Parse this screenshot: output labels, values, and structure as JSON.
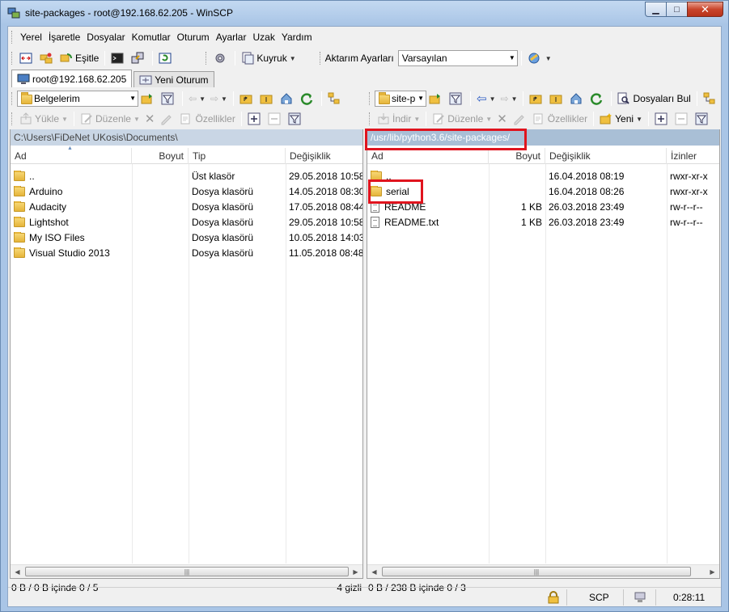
{
  "window": {
    "title": "site-packages - root@192.168.62.205 - WinSCP",
    "controls": {
      "minimize": "▁",
      "maximize": "□",
      "close": "✕"
    }
  },
  "menu": [
    "Yerel",
    "İşaretle",
    "Dosyalar",
    "Komutlar",
    "Oturum",
    "Ayarlar",
    "Uzak",
    "Yardım"
  ],
  "main_toolbar": {
    "sync_label": "Eşitle",
    "queue_label": "Kuyruk",
    "transfer_settings_label": "Aktarım Ayarları",
    "transfer_preset": "Varsayılan"
  },
  "tabs": [
    {
      "label": "root@192.168.62.205",
      "active": true
    },
    {
      "label": "Yeni Oturum",
      "active": false
    }
  ],
  "left": {
    "location": "Belgelerim",
    "actions": {
      "upload": "Yükle",
      "edit": "Düzenle",
      "properties": "Özellikler"
    },
    "path": "C:\\Users\\FiDeNet UKosis\\Documents\\",
    "columns": {
      "name": "Ad",
      "size": "Boyut",
      "type": "Tip",
      "modified": "Değişiklik"
    },
    "rows": [
      {
        "name": "..",
        "size": "",
        "type": "Üst klasör",
        "modified": "29.05.2018  10:58",
        "icon": "parent-folder"
      },
      {
        "name": "Arduino",
        "size": "",
        "type": "Dosya klasörü",
        "modified": "14.05.2018  08:30",
        "icon": "folder"
      },
      {
        "name": "Audacity",
        "size": "",
        "type": "Dosya klasörü",
        "modified": "17.05.2018  08:44",
        "icon": "folder"
      },
      {
        "name": "Lightshot",
        "size": "",
        "type": "Dosya klasörü",
        "modified": "29.05.2018  10:58",
        "icon": "folder"
      },
      {
        "name": "My ISO Files",
        "size": "",
        "type": "Dosya klasörü",
        "modified": "10.05.2018  14:03",
        "icon": "folder"
      },
      {
        "name": "Visual Studio 2013",
        "size": "",
        "type": "Dosya klasörü",
        "modified": "11.05.2018  08:48",
        "icon": "folder"
      }
    ],
    "status": "0 B / 0 B içinde 0 / 5",
    "hidden": "4 gizli"
  },
  "right": {
    "location": "site-p",
    "find_files_label": "Dosyaları Bul",
    "actions": {
      "download": "İndir",
      "edit": "Düzenle",
      "properties": "Özellikler",
      "new": "Yeni"
    },
    "path": "/usr/lib/python3.6/site-packages/",
    "columns": {
      "name": "Ad",
      "size": "Boyut",
      "modified": "Değişiklik",
      "rights": "İzinler"
    },
    "rows": [
      {
        "name": "..",
        "size": "",
        "modified": "16.04.2018  08:19",
        "rights": "rwxr-xr-x",
        "icon": "parent-folder"
      },
      {
        "name": "serial",
        "size": "",
        "modified": "16.04.2018  08:26",
        "rights": "rwxr-xr-x",
        "icon": "folder"
      },
      {
        "name": "README",
        "size": "1 KB",
        "modified": "26.03.2018  23:49",
        "rights": "rw-r--r--",
        "icon": "file"
      },
      {
        "name": "README.txt",
        "size": "1 KB",
        "modified": "26.03.2018  23:49",
        "rights": "rw-r--r--",
        "icon": "file"
      }
    ],
    "status": "0 B / 238 B içinde 0 / 3"
  },
  "statusbar": {
    "protocol": "SCP",
    "elapsed": "0:28:11"
  },
  "colors": {
    "highlight": "#e0141e",
    "remote_path_bg": "#a9bfd6",
    "title_bg": "#b9d1ea"
  }
}
